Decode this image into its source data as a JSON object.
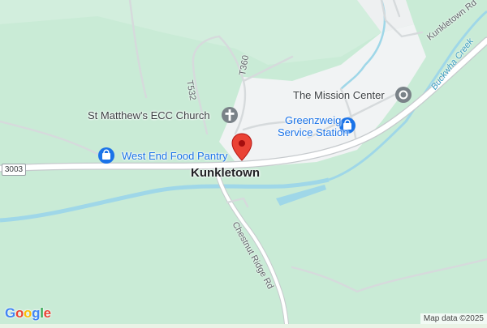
{
  "map": {
    "town": "Kunkletown",
    "places": {
      "church": "St Matthew's ECC Church",
      "mission": "The Mission Center",
      "food_pantry": "West End Food Pantry",
      "station_line1": "Greenzweig",
      "station_line2": "Service Station"
    },
    "roads": {
      "kunkletown_rd": "Kunkletown Rd",
      "chestnut_ridge_rd": "Chestnut Ridge Rd",
      "t532": "T532",
      "t360": "T360",
      "route_shield": "3003"
    },
    "water": {
      "creek": "Buckwha Creek"
    },
    "icons": {
      "pin": "location-pin-icon",
      "church": "cross-icon",
      "mission": "place-dot-icon",
      "shop": "shopping-bag-icon"
    },
    "colors": {
      "land": "#e9f3e6",
      "forest": "#c9ebd6",
      "urban": "#f1f3f4",
      "road": "#ffffff",
      "road_outline": "#c6cacd",
      "water": "#9fd7e8",
      "pin": "#ea4335",
      "poi_blue": "#1a73e8",
      "poi_gray": "#7a8288"
    }
  },
  "footer": {
    "logo": [
      "G",
      "o",
      "o",
      "g",
      "l",
      "e"
    ],
    "attribution": "Map data ©2025"
  }
}
